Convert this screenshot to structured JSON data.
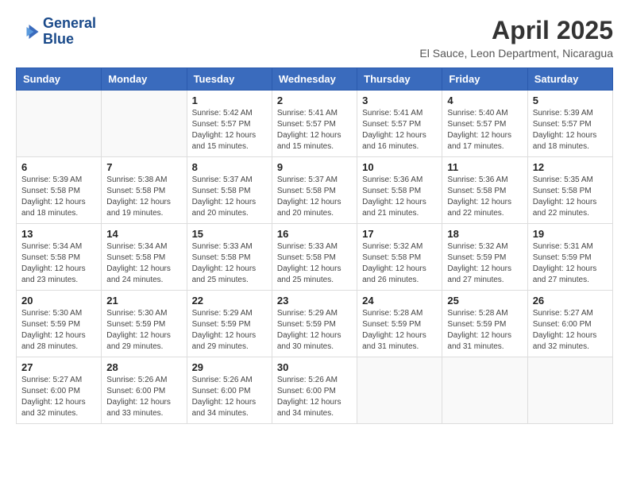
{
  "header": {
    "logo_line1": "General",
    "logo_line2": "Blue",
    "month_year": "April 2025",
    "location": "El Sauce, Leon Department, Nicaragua"
  },
  "weekdays": [
    "Sunday",
    "Monday",
    "Tuesday",
    "Wednesday",
    "Thursday",
    "Friday",
    "Saturday"
  ],
  "weeks": [
    [
      {
        "day": "",
        "sunrise": "",
        "sunset": "",
        "daylight": ""
      },
      {
        "day": "",
        "sunrise": "",
        "sunset": "",
        "daylight": ""
      },
      {
        "day": "1",
        "sunrise": "Sunrise: 5:42 AM",
        "sunset": "Sunset: 5:57 PM",
        "daylight": "Daylight: 12 hours and 15 minutes."
      },
      {
        "day": "2",
        "sunrise": "Sunrise: 5:41 AM",
        "sunset": "Sunset: 5:57 PM",
        "daylight": "Daylight: 12 hours and 15 minutes."
      },
      {
        "day": "3",
        "sunrise": "Sunrise: 5:41 AM",
        "sunset": "Sunset: 5:57 PM",
        "daylight": "Daylight: 12 hours and 16 minutes."
      },
      {
        "day": "4",
        "sunrise": "Sunrise: 5:40 AM",
        "sunset": "Sunset: 5:57 PM",
        "daylight": "Daylight: 12 hours and 17 minutes."
      },
      {
        "day": "5",
        "sunrise": "Sunrise: 5:39 AM",
        "sunset": "Sunset: 5:57 PM",
        "daylight": "Daylight: 12 hours and 18 minutes."
      }
    ],
    [
      {
        "day": "6",
        "sunrise": "Sunrise: 5:39 AM",
        "sunset": "Sunset: 5:58 PM",
        "daylight": "Daylight: 12 hours and 18 minutes."
      },
      {
        "day": "7",
        "sunrise": "Sunrise: 5:38 AM",
        "sunset": "Sunset: 5:58 PM",
        "daylight": "Daylight: 12 hours and 19 minutes."
      },
      {
        "day": "8",
        "sunrise": "Sunrise: 5:37 AM",
        "sunset": "Sunset: 5:58 PM",
        "daylight": "Daylight: 12 hours and 20 minutes."
      },
      {
        "day": "9",
        "sunrise": "Sunrise: 5:37 AM",
        "sunset": "Sunset: 5:58 PM",
        "daylight": "Daylight: 12 hours and 20 minutes."
      },
      {
        "day": "10",
        "sunrise": "Sunrise: 5:36 AM",
        "sunset": "Sunset: 5:58 PM",
        "daylight": "Daylight: 12 hours and 21 minutes."
      },
      {
        "day": "11",
        "sunrise": "Sunrise: 5:36 AM",
        "sunset": "Sunset: 5:58 PM",
        "daylight": "Daylight: 12 hours and 22 minutes."
      },
      {
        "day": "12",
        "sunrise": "Sunrise: 5:35 AM",
        "sunset": "Sunset: 5:58 PM",
        "daylight": "Daylight: 12 hours and 22 minutes."
      }
    ],
    [
      {
        "day": "13",
        "sunrise": "Sunrise: 5:34 AM",
        "sunset": "Sunset: 5:58 PM",
        "daylight": "Daylight: 12 hours and 23 minutes."
      },
      {
        "day": "14",
        "sunrise": "Sunrise: 5:34 AM",
        "sunset": "Sunset: 5:58 PM",
        "daylight": "Daylight: 12 hours and 24 minutes."
      },
      {
        "day": "15",
        "sunrise": "Sunrise: 5:33 AM",
        "sunset": "Sunset: 5:58 PM",
        "daylight": "Daylight: 12 hours and 25 minutes."
      },
      {
        "day": "16",
        "sunrise": "Sunrise: 5:33 AM",
        "sunset": "Sunset: 5:58 PM",
        "daylight": "Daylight: 12 hours and 25 minutes."
      },
      {
        "day": "17",
        "sunrise": "Sunrise: 5:32 AM",
        "sunset": "Sunset: 5:58 PM",
        "daylight": "Daylight: 12 hours and 26 minutes."
      },
      {
        "day": "18",
        "sunrise": "Sunrise: 5:32 AM",
        "sunset": "Sunset: 5:59 PM",
        "daylight": "Daylight: 12 hours and 27 minutes."
      },
      {
        "day": "19",
        "sunrise": "Sunrise: 5:31 AM",
        "sunset": "Sunset: 5:59 PM",
        "daylight": "Daylight: 12 hours and 27 minutes."
      }
    ],
    [
      {
        "day": "20",
        "sunrise": "Sunrise: 5:30 AM",
        "sunset": "Sunset: 5:59 PM",
        "daylight": "Daylight: 12 hours and 28 minutes."
      },
      {
        "day": "21",
        "sunrise": "Sunrise: 5:30 AM",
        "sunset": "Sunset: 5:59 PM",
        "daylight": "Daylight: 12 hours and 29 minutes."
      },
      {
        "day": "22",
        "sunrise": "Sunrise: 5:29 AM",
        "sunset": "Sunset: 5:59 PM",
        "daylight": "Daylight: 12 hours and 29 minutes."
      },
      {
        "day": "23",
        "sunrise": "Sunrise: 5:29 AM",
        "sunset": "Sunset: 5:59 PM",
        "daylight": "Daylight: 12 hours and 30 minutes."
      },
      {
        "day": "24",
        "sunrise": "Sunrise: 5:28 AM",
        "sunset": "Sunset: 5:59 PM",
        "daylight": "Daylight: 12 hours and 31 minutes."
      },
      {
        "day": "25",
        "sunrise": "Sunrise: 5:28 AM",
        "sunset": "Sunset: 5:59 PM",
        "daylight": "Daylight: 12 hours and 31 minutes."
      },
      {
        "day": "26",
        "sunrise": "Sunrise: 5:27 AM",
        "sunset": "Sunset: 6:00 PM",
        "daylight": "Daylight: 12 hours and 32 minutes."
      }
    ],
    [
      {
        "day": "27",
        "sunrise": "Sunrise: 5:27 AM",
        "sunset": "Sunset: 6:00 PM",
        "daylight": "Daylight: 12 hours and 32 minutes."
      },
      {
        "day": "28",
        "sunrise": "Sunrise: 5:26 AM",
        "sunset": "Sunset: 6:00 PM",
        "daylight": "Daylight: 12 hours and 33 minutes."
      },
      {
        "day": "29",
        "sunrise": "Sunrise: 5:26 AM",
        "sunset": "Sunset: 6:00 PM",
        "daylight": "Daylight: 12 hours and 34 minutes."
      },
      {
        "day": "30",
        "sunrise": "Sunrise: 5:26 AM",
        "sunset": "Sunset: 6:00 PM",
        "daylight": "Daylight: 12 hours and 34 minutes."
      },
      {
        "day": "",
        "sunrise": "",
        "sunset": "",
        "daylight": ""
      },
      {
        "day": "",
        "sunrise": "",
        "sunset": "",
        "daylight": ""
      },
      {
        "day": "",
        "sunrise": "",
        "sunset": "",
        "daylight": ""
      }
    ]
  ]
}
